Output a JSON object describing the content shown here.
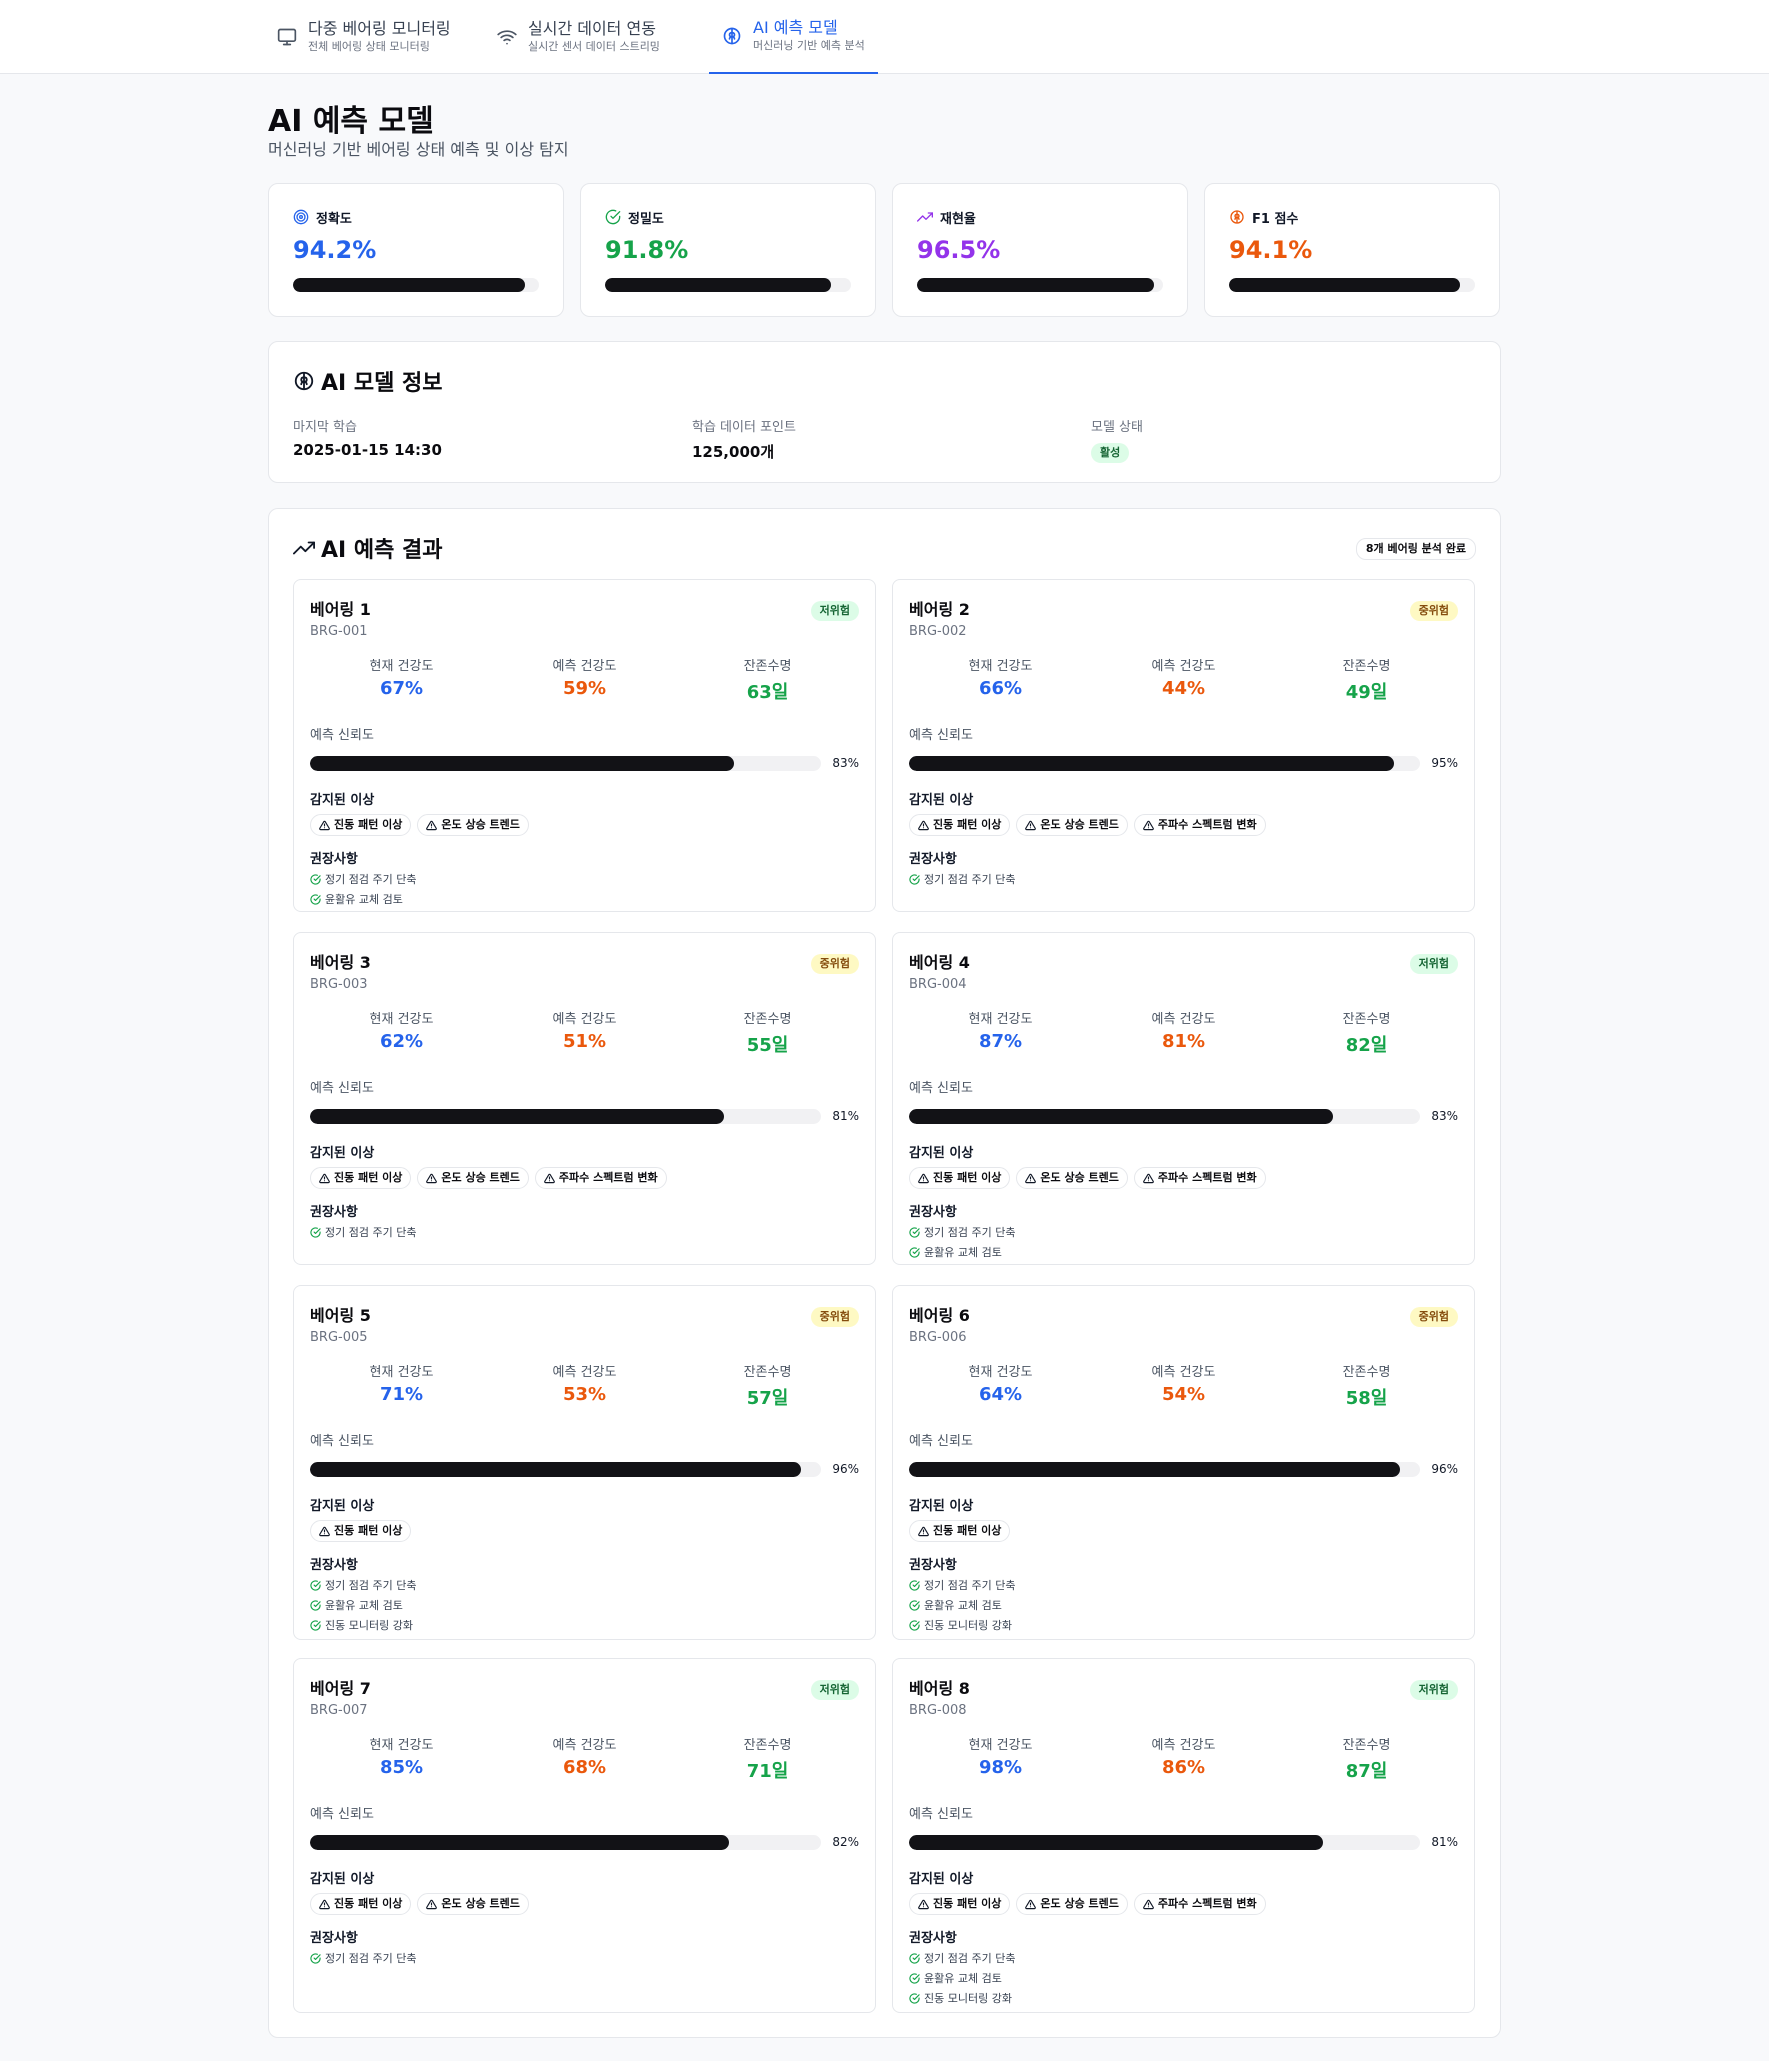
{
  "nav": {
    "tabs": [
      {
        "title": "다중 베어링 모니터링",
        "subtitle": "전체 베어링 상태 모니터링",
        "icon": "monitor-icon"
      },
      {
        "title": "실시간 데이터 연동",
        "subtitle": "실시간 센서 데이터 스트리밍",
        "icon": "wifi-icon"
      },
      {
        "title": "AI 예측 모델",
        "subtitle": "머신러닝 기반 예측 분석",
        "icon": "brain-icon"
      }
    ],
    "active_tab": 2
  },
  "header": {
    "title": "AI 예측 모델",
    "subtitle": "머신러닝 기반 베어링 상태 예측 및 이상 탐지"
  },
  "metrics": [
    {
      "label": "정확도",
      "value": "94.2%",
      "level": 94.2,
      "color": "#2563eb",
      "icon": "target-icon"
    },
    {
      "label": "정밀도",
      "value": "91.8%",
      "level": 91.8,
      "color": "#16a34a",
      "icon": "check-circle-icon"
    },
    {
      "label": "재현율",
      "value": "96.5%",
      "level": 96.5,
      "color": "#9333ea",
      "icon": "trending-up-icon"
    },
    {
      "label": "F1 점수",
      "value": "94.1%",
      "level": 94.1,
      "color": "#ea580c",
      "icon": "brain-icon"
    }
  ],
  "model_info": {
    "title": "AI 모델 정보",
    "last_training_label": "마지막 학습",
    "last_training_value": "2025-01-15 14:30",
    "data_points_label": "학습 데이터 포인트",
    "data_points_value": "125,000개",
    "status_label": "모델 상태",
    "status_value": "활성"
  },
  "results": {
    "title": "AI 예측 결과",
    "count_badge": "8개 베어링 분석 완료",
    "labels": {
      "current_health": "현재 건강도",
      "predicted_health": "예측 건강도",
      "remaining_life": "잔존수명",
      "confidence": "예측 신뢰도",
      "anomalies": "감지된 이상",
      "recommendations": "권장사항"
    },
    "bearings": [
      {
        "name": "베어링 1",
        "code": "BRG-001",
        "risk": "저위험",
        "risk_level": "low",
        "current": "67%",
        "predicted": "59%",
        "life": "63일",
        "confidence": 83,
        "confidence_label": "83%",
        "anomalies": [
          "진동 패턴 이상",
          "온도 상승 트렌드"
        ],
        "recommendations": [
          "정기 점검 주기 단축",
          "윤활유 교체 검토"
        ]
      },
      {
        "name": "베어링 2",
        "code": "BRG-002",
        "risk": "중위험",
        "risk_level": "mid",
        "current": "66%",
        "predicted": "44%",
        "life": "49일",
        "confidence": 95,
        "confidence_label": "95%",
        "anomalies": [
          "진동 패턴 이상",
          "온도 상승 트렌드",
          "주파수 스펙트럼 변화"
        ],
        "recommendations": [
          "정기 점검 주기 단축"
        ]
      },
      {
        "name": "베어링 3",
        "code": "BRG-003",
        "risk": "중위험",
        "risk_level": "mid",
        "current": "62%",
        "predicted": "51%",
        "life": "55일",
        "confidence": 81,
        "confidence_label": "81%",
        "anomalies": [
          "진동 패턴 이상",
          "온도 상승 트렌드",
          "주파수 스펙트럼 변화"
        ],
        "recommendations": [
          "정기 점검 주기 단축"
        ]
      },
      {
        "name": "베어링 4",
        "code": "BRG-004",
        "risk": "저위험",
        "risk_level": "low",
        "current": "87%",
        "predicted": "81%",
        "life": "82일",
        "confidence": 83,
        "confidence_label": "83%",
        "anomalies": [
          "진동 패턴 이상",
          "온도 상승 트렌드",
          "주파수 스펙트럼 변화"
        ],
        "recommendations": [
          "정기 점검 주기 단축",
          "윤활유 교체 검토"
        ]
      },
      {
        "name": "베어링 5",
        "code": "BRG-005",
        "risk": "중위험",
        "risk_level": "mid",
        "current": "71%",
        "predicted": "53%",
        "life": "57일",
        "confidence": 96,
        "confidence_label": "96%",
        "anomalies": [
          "진동 패턴 이상"
        ],
        "recommendations": [
          "정기 점검 주기 단축",
          "윤활유 교체 검토",
          "진동 모니터링 강화"
        ]
      },
      {
        "name": "베어링 6",
        "code": "BRG-006",
        "risk": "중위험",
        "risk_level": "mid",
        "current": "64%",
        "predicted": "54%",
        "life": "58일",
        "confidence": 96,
        "confidence_label": "96%",
        "anomalies": [
          "진동 패턴 이상"
        ],
        "recommendations": [
          "정기 점검 주기 단축",
          "윤활유 교체 검토",
          "진동 모니터링 강화"
        ]
      },
      {
        "name": "베어링 7",
        "code": "BRG-007",
        "risk": "저위험",
        "risk_level": "low",
        "current": "85%",
        "predicted": "68%",
        "life": "71일",
        "confidence": 82,
        "confidence_label": "82%",
        "anomalies": [
          "진동 패턴 이상",
          "온도 상승 트렌드"
        ],
        "recommendations": [
          "정기 점검 주기 단축"
        ]
      },
      {
        "name": "베어링 8",
        "code": "BRG-008",
        "risk": "저위험",
        "risk_level": "low",
        "current": "98%",
        "predicted": "86%",
        "life": "87일",
        "confidence": 81,
        "confidence_label": "81%",
        "anomalies": [
          "진동 패턴 이상",
          "온도 상승 트렌드",
          "주파수 스펙트럼 변화"
        ],
        "recommendations": [
          "정기 점검 주기 단축",
          "윤활유 교체 검토",
          "진동 모니터링 강화"
        ]
      }
    ]
  }
}
